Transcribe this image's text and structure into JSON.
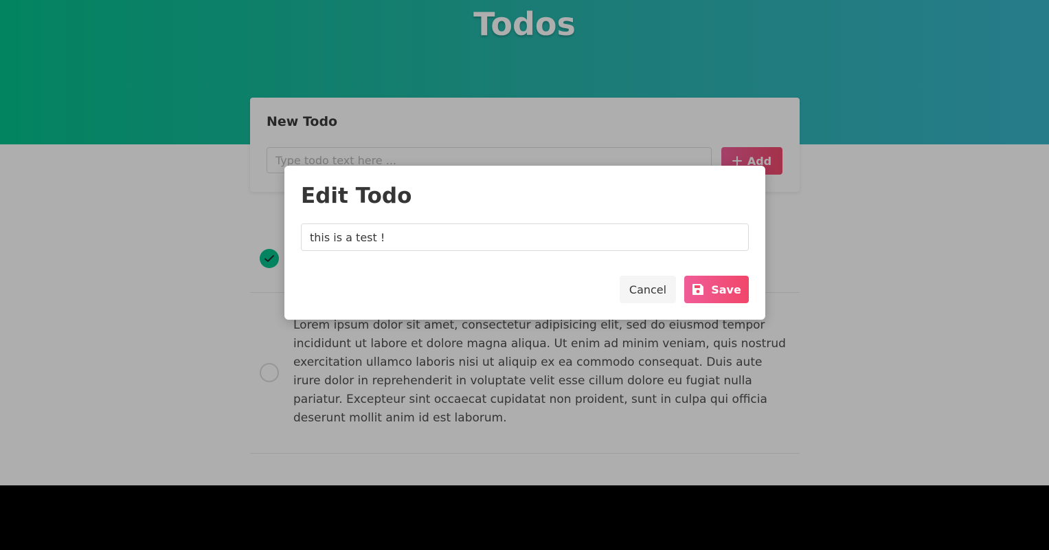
{
  "header": {
    "title": "Todos",
    "gradient": [
      "#00c08b",
      "#36b5c9"
    ]
  },
  "new_todo": {
    "title": "New Todo",
    "placeholder": "Type todo text here ...",
    "add_label": "Add",
    "accent": "#f1466a"
  },
  "todos": [
    {
      "text": "",
      "completed": true,
      "check_color": "#00c08b"
    },
    {
      "text": "Lorem ipsum dolor sit amet, consectetur adipisicing elit, sed do eiusmod tempor incididunt ut labore et dolore magna aliqua. Ut enim ad minim veniam, quis nostrud exercitation ullamco laboris nisi ut aliquip ex ea commodo consequat. Duis aute irure dolor in reprehenderit in voluptate velit esse cillum dolore eu fugiat nulla pariatur. Excepteur sint occaecat cupidatat non proident, sunt in culpa qui officia deserunt mollit anim id est laborum.",
      "completed": false
    }
  ],
  "edit_modal": {
    "title": "Edit Todo",
    "value": "this is a test !",
    "cancel_label": "Cancel",
    "save_label": "Save",
    "save_icon": "floppy-disk-icon"
  }
}
